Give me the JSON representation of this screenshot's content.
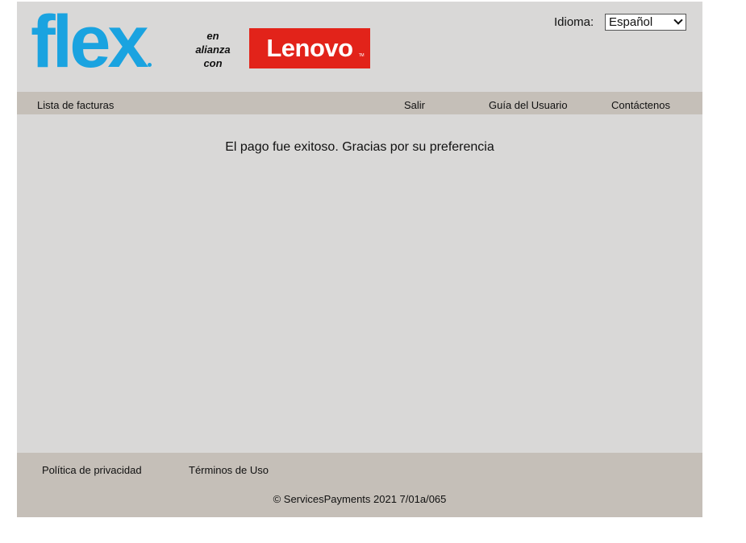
{
  "header": {
    "flex_logo_text": "flex",
    "alliance_lines": [
      "en",
      "alianza",
      "con"
    ],
    "lenovo_logo_text": "Lenovo",
    "lenovo_tm": "TM",
    "language_label": "Idioma:",
    "language_selected": "Español"
  },
  "nav": {
    "invoices": "Lista de facturas",
    "logout": "Salir",
    "user_guide": "Guía del Usuario",
    "contact": "Contáctenos"
  },
  "main": {
    "message": "El pago fue exitoso. Gracias por su preferencia"
  },
  "footer": {
    "privacy": "Política de privacidad",
    "terms": "Términos de Uso",
    "copyright": "© ServicesPayments 2021 7/01a/065"
  },
  "colors": {
    "flex_blue": "#1aa3e0",
    "lenovo_red": "#e2231a",
    "bar_tan": "#c5bfb8",
    "panel_gray": "#d9d8d7"
  }
}
